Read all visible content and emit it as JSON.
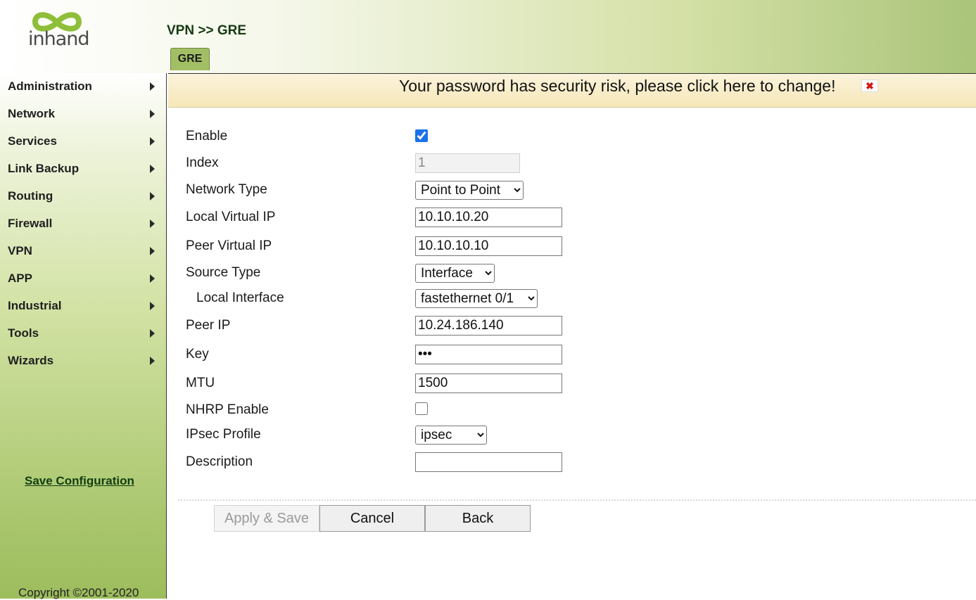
{
  "header": {
    "logo_text": "inhand",
    "breadcrumb": "VPN >> GRE",
    "tab_label": "GRE"
  },
  "sidebar": {
    "items": [
      {
        "label": "Administration"
      },
      {
        "label": "Network"
      },
      {
        "label": "Services"
      },
      {
        "label": "Link Backup"
      },
      {
        "label": "Routing"
      },
      {
        "label": "Firewall"
      },
      {
        "label": "VPN"
      },
      {
        "label": "APP"
      },
      {
        "label": "Industrial"
      },
      {
        "label": "Tools"
      },
      {
        "label": "Wizards"
      }
    ],
    "save_config": "Save Configuration",
    "copyright": "Copyright ©2001-2020"
  },
  "banner": {
    "text": "Your password has security risk, please click here to change!",
    "close_glyph": "✖"
  },
  "form": {
    "enable": {
      "label": "Enable",
      "checked": true
    },
    "index": {
      "label": "Index",
      "value": "1"
    },
    "network_type": {
      "label": "Network Type",
      "value": "Point to Point"
    },
    "local_virtual_ip": {
      "label": "Local Virtual IP",
      "value": "10.10.10.20"
    },
    "peer_virtual_ip": {
      "label": "Peer Virtual IP",
      "value": "10.10.10.10"
    },
    "source_type": {
      "label": "Source Type",
      "value": "Interface"
    },
    "local_interface": {
      "label": "Local Interface",
      "value": "fastethernet 0/1"
    },
    "peer_ip": {
      "label": "Peer IP",
      "value": "10.24.186.140"
    },
    "key": {
      "label": "Key",
      "value": "•••"
    },
    "mtu": {
      "label": "MTU",
      "value": "1500"
    },
    "nhrp_enable": {
      "label": "NHRP Enable",
      "checked": false
    },
    "ipsec_profile": {
      "label": "IPsec Profile",
      "value": "ipsec"
    },
    "description": {
      "label": "Description",
      "value": ""
    }
  },
  "buttons": {
    "apply_save": "Apply & Save",
    "cancel": "Cancel",
    "back": "Back"
  },
  "colors": {
    "accent_green": "#a3bf66",
    "banner_bg": "#f6e7b8",
    "link_green": "#123d10"
  }
}
